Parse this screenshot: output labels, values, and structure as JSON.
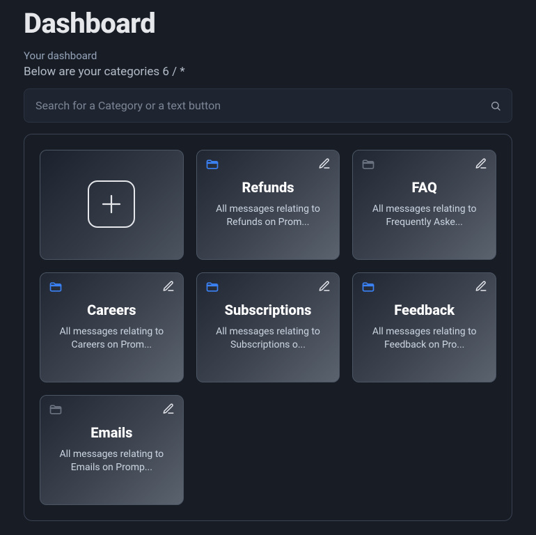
{
  "header": {
    "title": "Dashboard",
    "subtitle": "Your dashboard",
    "subline": "Below are your categories 6 / *"
  },
  "search": {
    "placeholder": "Search for a Category or a text button",
    "value": ""
  },
  "categories": [
    {
      "type": "add"
    },
    {
      "title": "Refunds",
      "description": "All messages relating to Refunds on Prom...",
      "folder": "blue"
    },
    {
      "title": "FAQ",
      "description": "All messages relating to Frequently Aske...",
      "folder": "grey"
    },
    {
      "title": "Careers",
      "description": "All messages relating to Careers on Prom...",
      "folder": "blue"
    },
    {
      "title": "Subscriptions",
      "description": "All messages relating to Subscriptions o...",
      "folder": "blue"
    },
    {
      "title": "Feedback",
      "description": "All messages relating to Feedback on Pro...",
      "folder": "blue"
    },
    {
      "title": "Emails",
      "description": "All messages relating to Emails on Promp...",
      "folder": "grey"
    }
  ]
}
